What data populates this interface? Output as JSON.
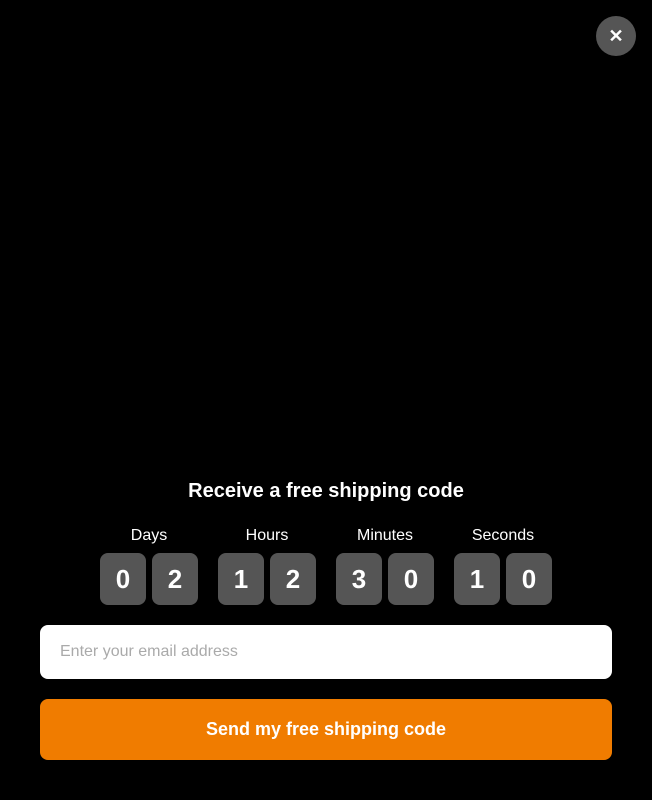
{
  "close_button": {
    "label": "×",
    "aria": "Close dialog"
  },
  "title": "Receive a free shipping code",
  "countdown": {
    "units": [
      {
        "label": "Days",
        "digits": [
          "0",
          "2"
        ]
      },
      {
        "label": "Hours",
        "digits": [
          "1",
          "2"
        ]
      },
      {
        "label": "Minutes",
        "digits": [
          "3",
          "0"
        ]
      },
      {
        "label": "Seconds",
        "digits": [
          "1",
          "0"
        ]
      }
    ]
  },
  "email_input": {
    "placeholder": "Enter your email address",
    "value": ""
  },
  "submit_button": {
    "label": "Send my free shipping code"
  }
}
